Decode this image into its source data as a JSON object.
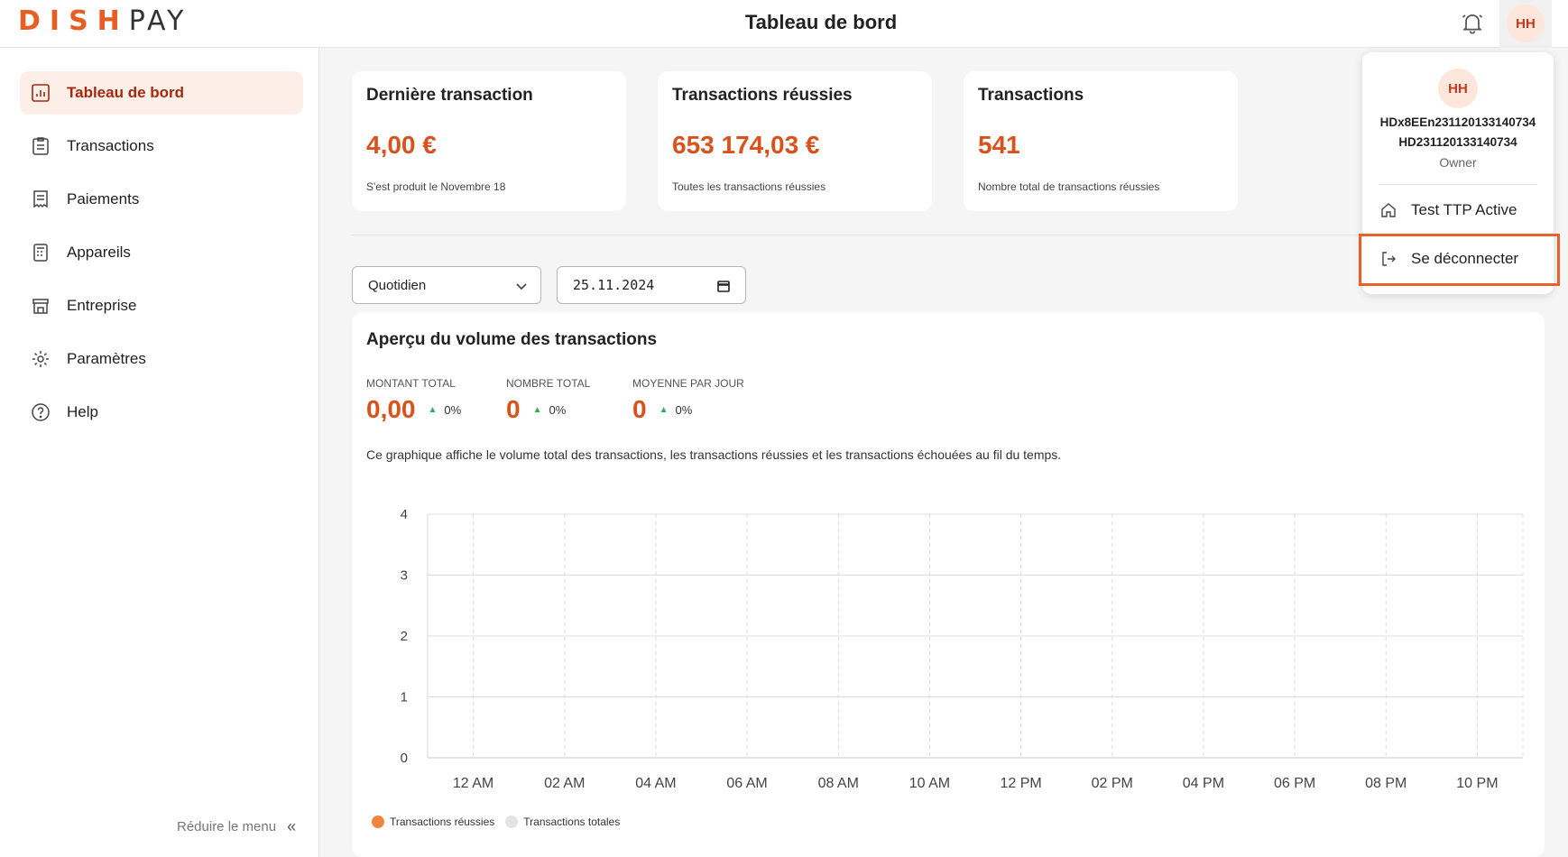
{
  "brand": {
    "dish": "DISH",
    "pay": "PAY",
    "accent": "#e85d24"
  },
  "header": {
    "title": "Tableau de bord",
    "avatar_initials": "HH"
  },
  "sidebar": {
    "items": [
      {
        "label": "Tableau de bord",
        "icon": "dashboard-icon",
        "active": true
      },
      {
        "label": "Transactions",
        "icon": "clipboard-icon"
      },
      {
        "label": "Paiements",
        "icon": "receipt-icon"
      },
      {
        "label": "Appareils",
        "icon": "device-icon"
      },
      {
        "label": "Entreprise",
        "icon": "store-icon"
      },
      {
        "label": "Paramètres",
        "icon": "gear-icon"
      },
      {
        "label": "Help",
        "icon": "help-icon"
      }
    ],
    "collapse_label": "Réduire le menu"
  },
  "cards": [
    {
      "title": "Dernière transaction",
      "value": "4,00 €",
      "subtitle": "S'est produit le Novembre 18"
    },
    {
      "title": "Transactions réussies",
      "value": "653 174,03 €",
      "subtitle": "Toutes les transactions réussies"
    },
    {
      "title": "Transactions",
      "value": "541",
      "subtitle": "Nombre total de transactions réussies"
    }
  ],
  "filters": {
    "period": "Quotidien",
    "date": "25.11.2024"
  },
  "panel": {
    "title": "Aperçu du volume des transactions",
    "metrics": [
      {
        "label": "MONTANT TOTAL",
        "value": "0,00",
        "change": "0%"
      },
      {
        "label": "NOMBRE TOTAL",
        "value": "0",
        "change": "0%"
      },
      {
        "label": "MOYENNE PAR JOUR",
        "value": "0",
        "change": "0%"
      }
    ],
    "description": "Ce graphique affiche le volume total des transactions, les transactions réussies et les transactions échouées au fil du temps."
  },
  "chart_data": {
    "type": "line",
    "x": [
      "12 AM",
      "02 AM",
      "04 AM",
      "06 AM",
      "08 AM",
      "10 AM",
      "12 PM",
      "02 PM",
      "04 PM",
      "06 PM",
      "08 PM",
      "10 PM"
    ],
    "yticks": [
      "0",
      "1",
      "2",
      "3",
      "4"
    ],
    "ylim": [
      0,
      4
    ],
    "series": [
      {
        "name": "Transactions réussies",
        "color": "#f2853e",
        "values": []
      },
      {
        "name": "Transactions totales",
        "color": "#e4e4e4",
        "values": []
      }
    ],
    "grid": true,
    "legend": "bottom-left"
  },
  "dropdown": {
    "initials": "HH",
    "line1": "HDx8EEn231120133140734",
    "line2": "HD231120133140734",
    "role": "Owner",
    "items": [
      {
        "label": "Test TTP Active",
        "icon": "home-icon"
      },
      {
        "label": "Se déconnecter",
        "icon": "logout-icon"
      }
    ],
    "highlight_color": "#e8612c"
  }
}
